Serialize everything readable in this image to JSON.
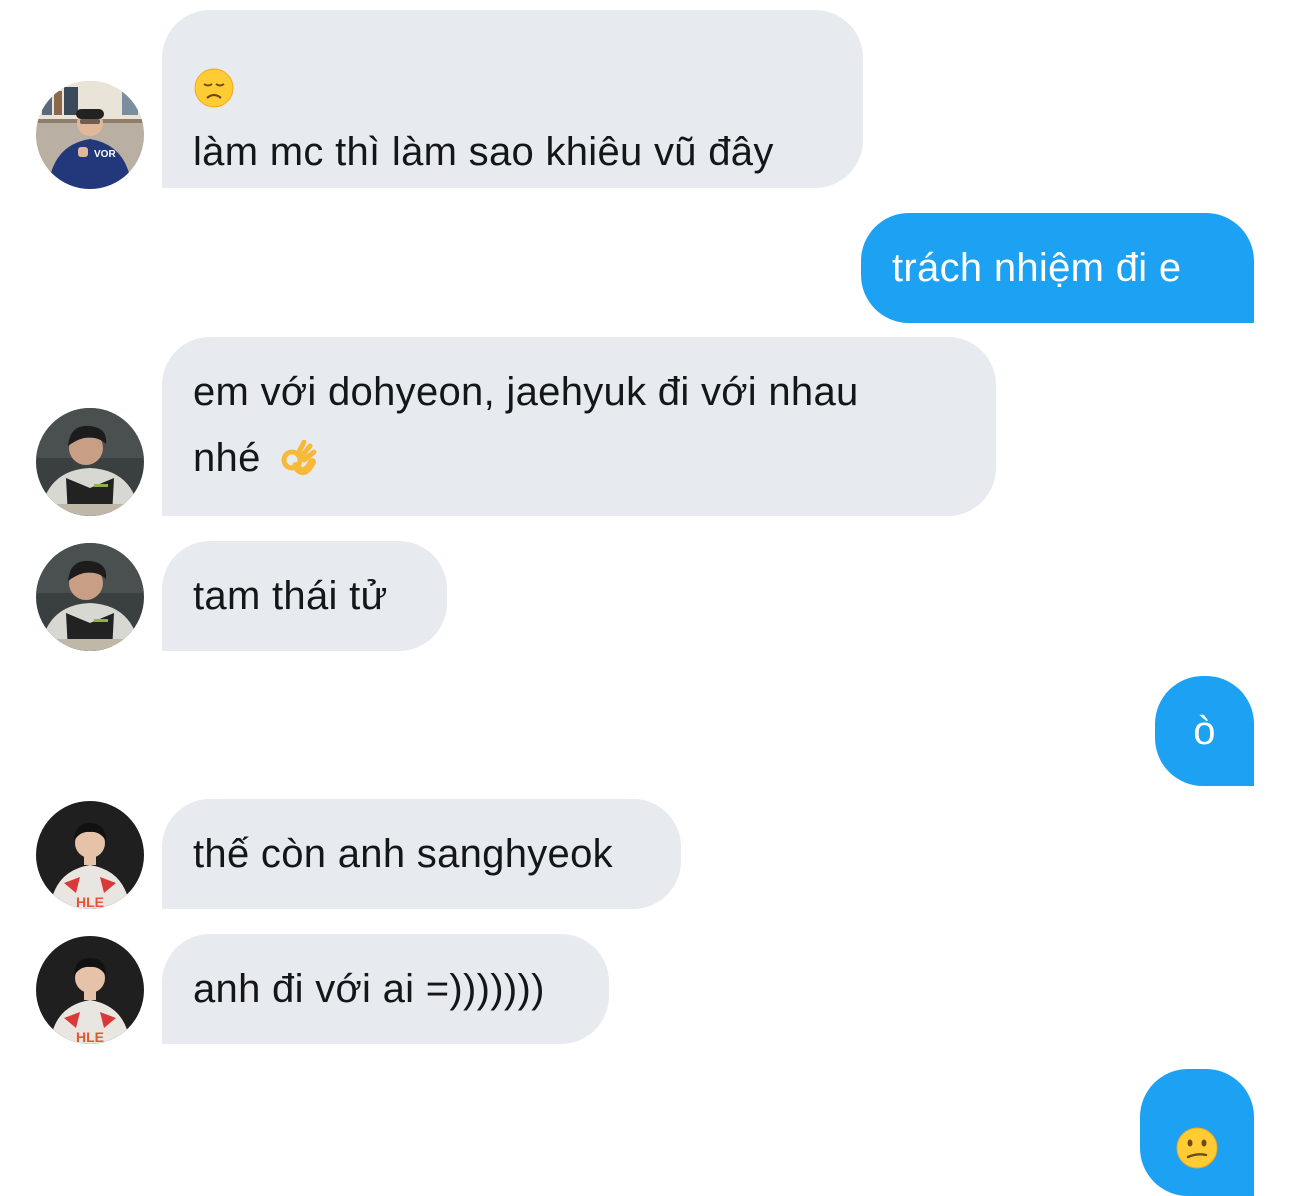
{
  "conversation": {
    "messages": [
      {
        "direction": "incoming",
        "emoji": "disappointed-face",
        "text": "làm mc thì làm sao khiêu vũ đây"
      },
      {
        "direction": "outgoing",
        "text": "trách nhiệm đi e"
      },
      {
        "direction": "incoming",
        "line1": "em với dohyeon, jaehyuk đi với nhau",
        "line2": "nhé",
        "emoji": "ok-hand"
      },
      {
        "direction": "incoming",
        "text": "tam thái tử"
      },
      {
        "direction": "outgoing",
        "text": "ò"
      },
      {
        "direction": "incoming",
        "text": "thế còn anh sanghyeok"
      },
      {
        "direction": "incoming",
        "text": "anh đi với ai =)))))))"
      },
      {
        "direction": "outgoing",
        "emoji": "confused-face"
      }
    ],
    "avatars": {
      "sender1": {
        "shirt_text": "VOR"
      },
      "sender3": {
        "jersey_text": "HLE"
      }
    }
  },
  "colors": {
    "incoming_bubble": "#e7eaee",
    "outgoing_bubble": "#1da1f2",
    "incoming_text": "#14171a",
    "outgoing_text": "#ffffff"
  }
}
